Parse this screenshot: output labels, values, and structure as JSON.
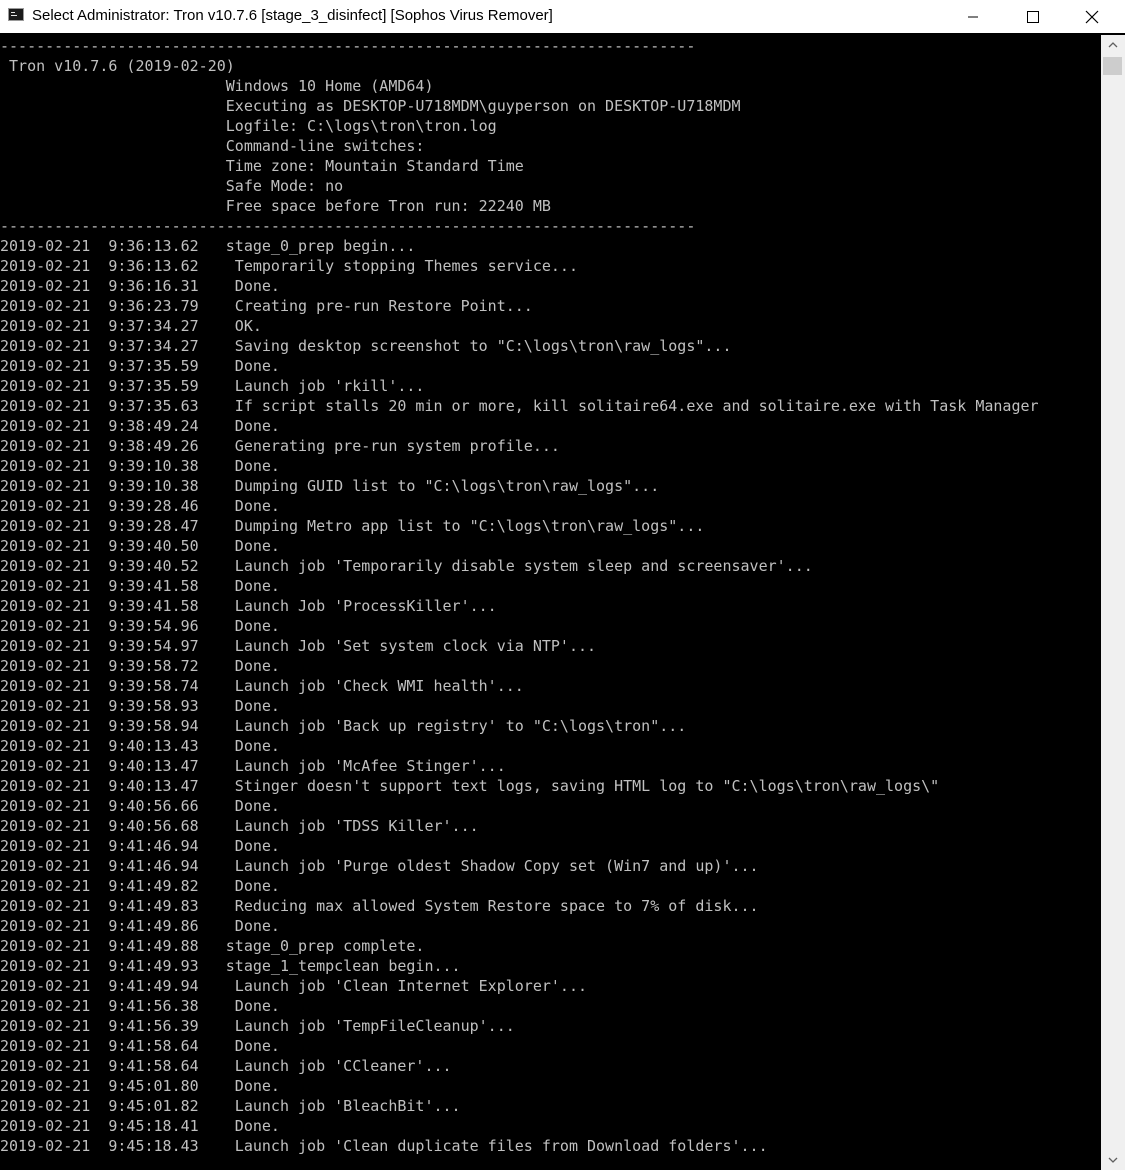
{
  "window": {
    "title": "Select Administrator:  Tron v10.7.6 [stage_3_disinfect] [Sophos Virus Remover]",
    "icon": "console-icon",
    "controls": [
      "minimize-icon",
      "maximize-icon",
      "close-icon"
    ]
  },
  "console": {
    "lines": [
      "-----------------------------------------------------------------------------",
      " Tron v10.7.6 (2019-02-20)",
      "                         Windows 10 Home (AMD64)",
      "                         Executing as DESKTOP-U718MDM\\guyperson on DESKTOP-U718MDM",
      "                         Logfile: C:\\logs\\tron\\tron.log",
      "                         Command-line switches:",
      "                         Time zone: Mountain Standard Time",
      "                         Safe Mode: no",
      "                         Free space before Tron run: 22240 MB",
      "-----------------------------------------------------------------------------",
      "2019-02-21  9:36:13.62   stage_0_prep begin...",
      "2019-02-21  9:36:13.62    Temporarily stopping Themes service...",
      "2019-02-21  9:36:16.31    Done.",
      "2019-02-21  9:36:23.79    Creating pre-run Restore Point...",
      "2019-02-21  9:37:34.27    OK.",
      "2019-02-21  9:37:34.27    Saving desktop screenshot to \"C:\\logs\\tron\\raw_logs\"...",
      "2019-02-21  9:37:35.59    Done.",
      "2019-02-21  9:37:35.59    Launch job 'rkill'...",
      "2019-02-21  9:37:35.63    If script stalls 20 min or more, kill solitaire64.exe and solitaire.exe with Task Manager",
      "2019-02-21  9:38:49.24    Done.",
      "2019-02-21  9:38:49.26    Generating pre-run system profile...",
      "2019-02-21  9:39:10.38    Done.",
      "2019-02-21  9:39:10.38    Dumping GUID list to \"C:\\logs\\tron\\raw_logs\"...",
      "2019-02-21  9:39:28.46    Done.",
      "2019-02-21  9:39:28.47    Dumping Metro app list to \"C:\\logs\\tron\\raw_logs\"...",
      "2019-02-21  9:39:40.50    Done.",
      "2019-02-21  9:39:40.52    Launch job 'Temporarily disable system sleep and screensaver'...",
      "2019-02-21  9:39:41.58    Done.",
      "2019-02-21  9:39:41.58    Launch Job 'ProcessKiller'...",
      "2019-02-21  9:39:54.96    Done.",
      "2019-02-21  9:39:54.97    Launch Job 'Set system clock via NTP'...",
      "2019-02-21  9:39:58.72    Done.",
      "2019-02-21  9:39:58.74    Launch job 'Check WMI health'...",
      "2019-02-21  9:39:58.93    Done.",
      "2019-02-21  9:39:58.94    Launch job 'Back up registry' to \"C:\\logs\\tron\"...",
      "2019-02-21  9:40:13.43    Done.",
      "2019-02-21  9:40:13.47    Launch job 'McAfee Stinger'...",
      "2019-02-21  9:40:13.47    Stinger doesn't support text logs, saving HTML log to \"C:\\logs\\tron\\raw_logs\\\"",
      "2019-02-21  9:40:56.66    Done.",
      "2019-02-21  9:40:56.68    Launch job 'TDSS Killer'...",
      "2019-02-21  9:41:46.94    Done.",
      "2019-02-21  9:41:46.94    Launch job 'Purge oldest Shadow Copy set (Win7 and up)'...",
      "2019-02-21  9:41:49.82    Done.",
      "2019-02-21  9:41:49.83    Reducing max allowed System Restore space to 7% of disk...",
      "2019-02-21  9:41:49.86    Done.",
      "2019-02-21  9:41:49.88   stage_0_prep complete.",
      "2019-02-21  9:41:49.93   stage_1_tempclean begin...",
      "2019-02-21  9:41:49.94    Launch job 'Clean Internet Explorer'...",
      "2019-02-21  9:41:56.38    Done.",
      "2019-02-21  9:41:56.39    Launch job 'TempFileCleanup'...",
      "2019-02-21  9:41:58.64    Done.",
      "2019-02-21  9:41:58.64    Launch job 'CCleaner'...",
      "2019-02-21  9:45:01.80    Done.",
      "2019-02-21  9:45:01.82    Launch job 'BleachBit'...",
      "2019-02-21  9:45:18.41    Done.",
      "2019-02-21  9:45:18.43    Launch job 'Clean duplicate files from Download folders'..."
    ]
  },
  "scrollbar": {
    "up_icon": "scroll-up-arrow-icon",
    "down_icon": "scroll-down-arrow-icon"
  },
  "colors": {
    "console_bg": "#000000",
    "console_text": "#c0c0c0",
    "titlebar_bg": "#ffffff",
    "scrollbar_bg": "#f0f0f0"
  }
}
